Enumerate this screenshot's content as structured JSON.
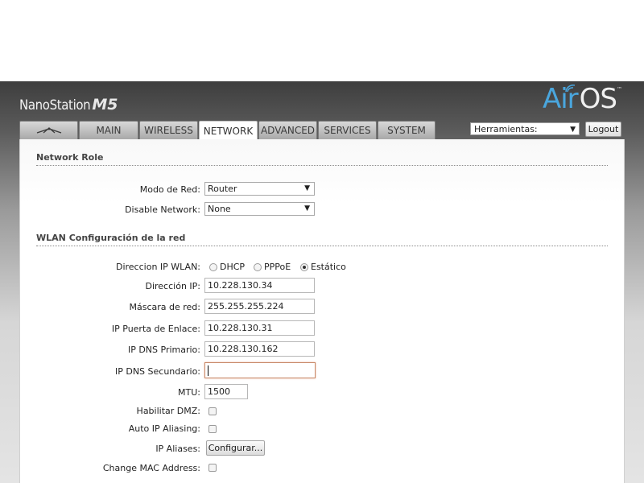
{
  "header": {
    "brand_name": "NanoStation",
    "brand_model": "M5",
    "logo_air": "Air",
    "logo_os": "OS",
    "logo_tm": "™"
  },
  "tabs": [
    {
      "label": "",
      "icon": "ubiquiti-logo-icon"
    },
    {
      "label": "MAIN"
    },
    {
      "label": "WIRELESS"
    },
    {
      "label": "NETWORK",
      "active": true
    },
    {
      "label": "ADVANCED"
    },
    {
      "label": "SERVICES"
    },
    {
      "label": "SYSTEM"
    }
  ],
  "tools": {
    "selected": "Herramientas:"
  },
  "logout_label": "Logout",
  "network_role": {
    "title": "Network Role",
    "mode_label": "Modo de Red:",
    "mode_value": "Router",
    "disable_label": "Disable Network:",
    "disable_value": "None"
  },
  "wlan": {
    "title": "WLAN Configuración de la red",
    "ip_mode_label": "Direccion IP WLAN:",
    "ip_mode_options": [
      "DHCP",
      "PPPoE",
      "Estático"
    ],
    "ip_mode_selected": "Estático",
    "ip_label": "Dirección IP:",
    "ip_value": "10.228.130.34",
    "mask_label": "Máscara de red:",
    "mask_value": "255.255.255.224",
    "gateway_label": "IP Puerta de Enlace:",
    "gateway_value": "10.228.130.31",
    "dns1_label": "IP DNS Primario:",
    "dns1_value": "10.228.130.162",
    "dns2_label": "IP DNS Secundario:",
    "dns2_value": "",
    "mtu_label": "MTU:",
    "mtu_value": "1500",
    "dmz_label": "Habilitar DMZ:",
    "dmz_checked": false,
    "aliasing_label": "Auto IP Aliasing:",
    "aliasing_checked": false,
    "aliases_label": "IP Aliases:",
    "aliases_button": "Configurar...",
    "mac_label": "Change MAC Address:",
    "mac_checked": false
  },
  "colors": {
    "accent_air": "#4aa6dd",
    "header_dark": "#3e3e3e",
    "focus_border": "#c98a6a"
  }
}
